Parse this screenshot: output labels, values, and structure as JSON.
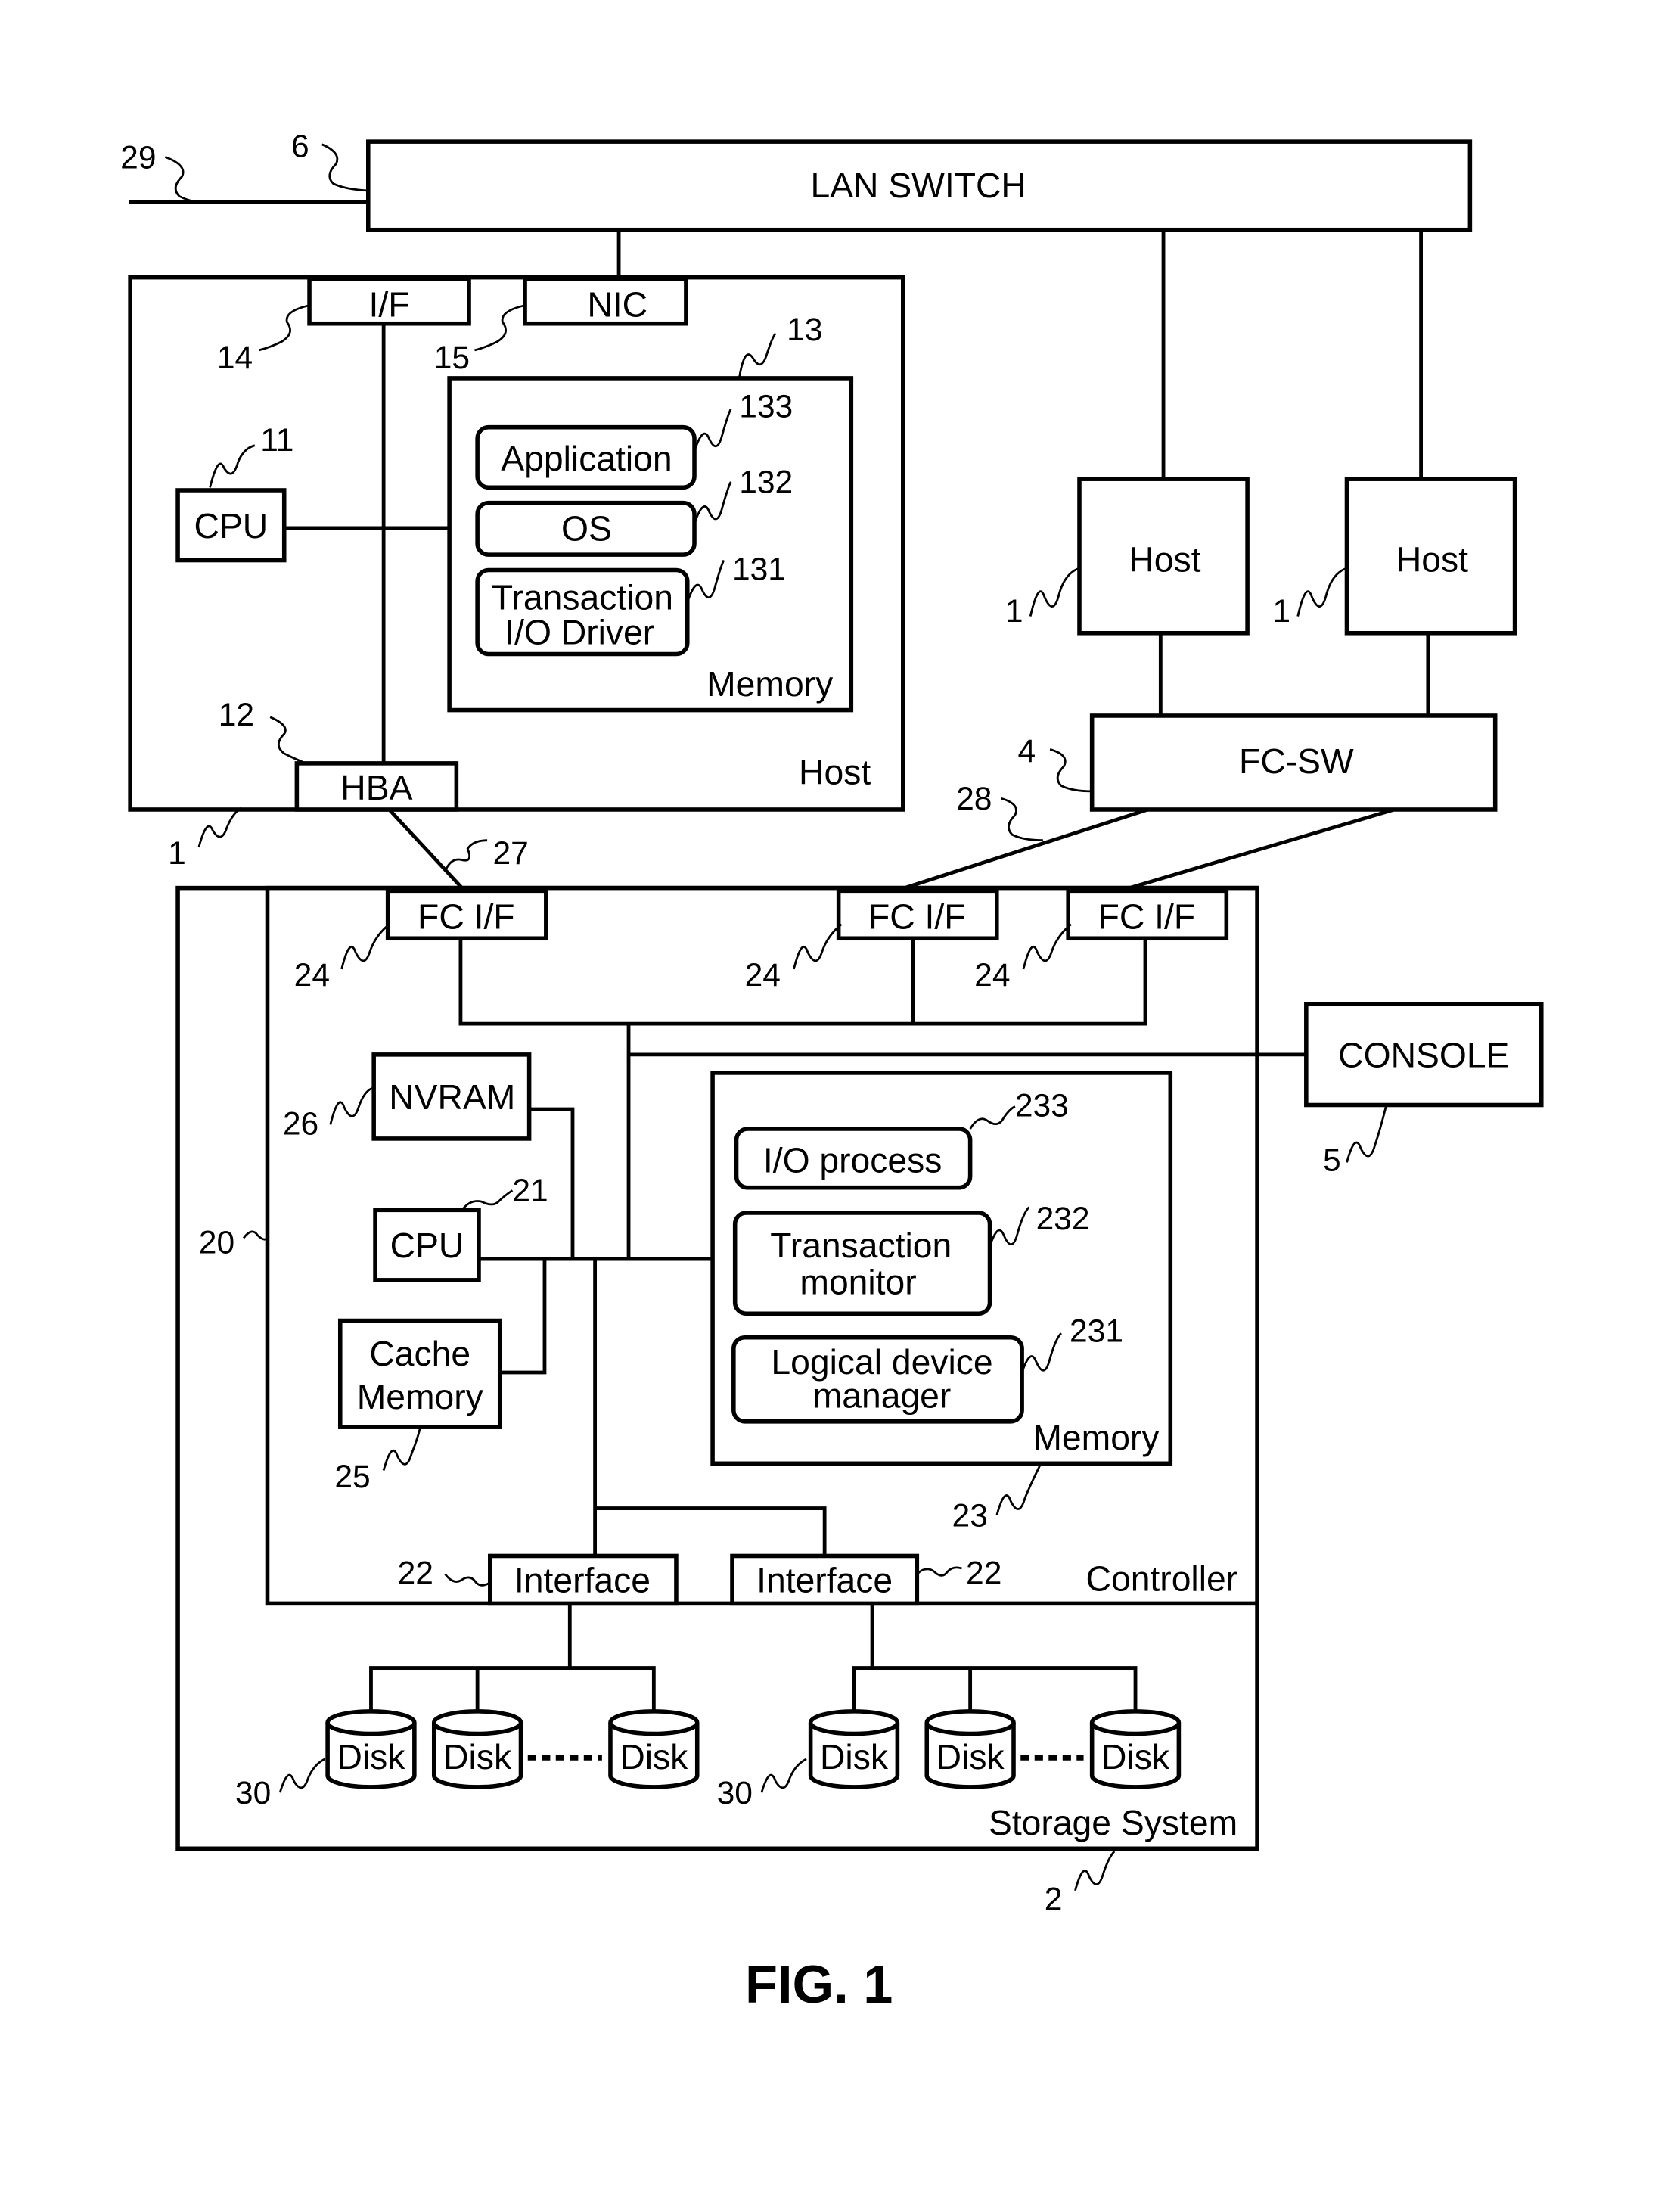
{
  "figure": {
    "caption": "FIG. 1",
    "colors": {
      "line": "#000000",
      "background": "#ffffff"
    }
  },
  "lan_switch": {
    "label": "LAN SWITCH",
    "ref": "6",
    "line_ref": "29"
  },
  "host_main": {
    "label": "Host",
    "ref": "1",
    "cpu": {
      "label": "CPU",
      "ref": "11"
    },
    "hba": {
      "label": "HBA",
      "ref": "12"
    },
    "interface": {
      "label": "I/F",
      "ref": "14"
    },
    "nic": {
      "label": "NIC",
      "ref": "15"
    },
    "memory": {
      "label": "Memory",
      "ref": "13",
      "items": [
        {
          "label": "Application",
          "ref": "133"
        },
        {
          "label": "OS",
          "ref": "132"
        },
        {
          "label_line1": "Transaction",
          "label_line2": "I/O Driver",
          "ref": "131"
        }
      ]
    }
  },
  "hosts_other": [
    {
      "label": "Host",
      "ref": "1"
    },
    {
      "label": "Host",
      "ref": "1"
    }
  ],
  "fc_switch": {
    "label": "FC-SW",
    "ref": "4",
    "line_ref": "28"
  },
  "hba_link_ref": "27",
  "console": {
    "label": "CONSOLE",
    "ref": "5"
  },
  "storage_system": {
    "label": "Storage System",
    "ref": "2",
    "controller": {
      "label": "Controller",
      "ref": "20",
      "fc_interfaces": [
        {
          "label": "FC I/F",
          "ref": "24"
        },
        {
          "label": "FC I/F",
          "ref": "24"
        },
        {
          "label": "FC I/F",
          "ref": "24"
        }
      ],
      "nvram": {
        "label": "NVRAM",
        "ref": "26"
      },
      "cpu": {
        "label": "CPU",
        "ref": "21"
      },
      "cache": {
        "label_line1": "Cache",
        "label_line2": "Memory",
        "ref": "25"
      },
      "memory": {
        "label": "Memory",
        "ref": "23",
        "items": [
          {
            "label": "I/O process",
            "ref": "233"
          },
          {
            "label_line1": "Transaction",
            "label_line2": "monitor",
            "ref": "232"
          },
          {
            "label_line1": "Logical device",
            "label_line2": "manager",
            "ref": "231"
          }
        ]
      },
      "interfaces": [
        {
          "label": "Interface",
          "ref": "22"
        },
        {
          "label": "Interface",
          "ref": "22"
        }
      ]
    },
    "disk_groups": [
      {
        "ref": "30",
        "disks": [
          "Disk",
          "Disk",
          "Disk"
        ]
      },
      {
        "ref": "30",
        "disks": [
          "Disk",
          "Disk",
          "Disk"
        ]
      }
    ]
  }
}
